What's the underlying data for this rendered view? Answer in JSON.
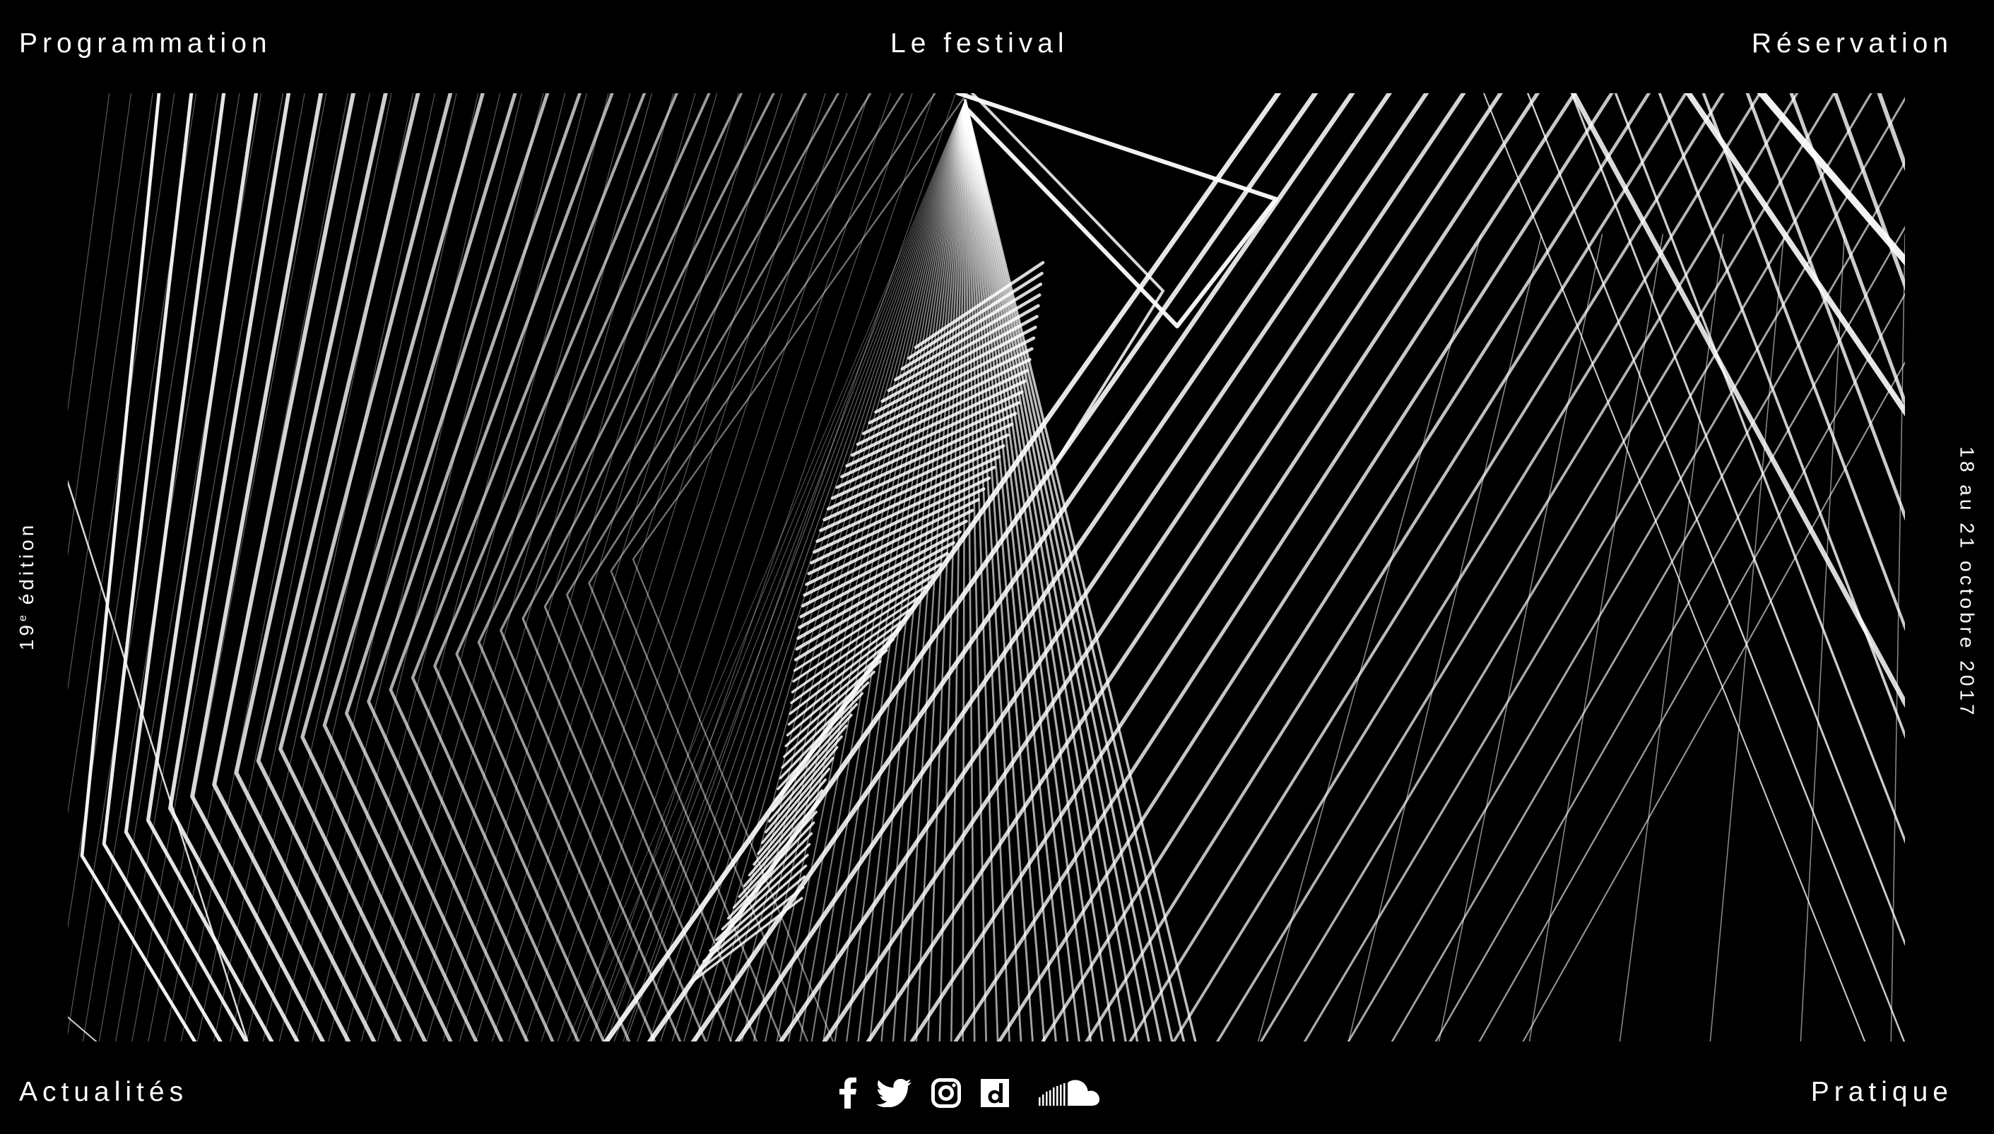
{
  "nav": {
    "top_left": "Programmation",
    "top_center": "Le festival",
    "top_right": "Réservation",
    "bottom_left": "Actualités",
    "bottom_right": "Pratique"
  },
  "side": {
    "edition_number": "19",
    "edition_suffix": "e",
    "edition_word": " édition",
    "dates": "18 au 21 octobre 2017"
  },
  "social": [
    {
      "icon": "facebook-icon"
    },
    {
      "icon": "twitter-icon"
    },
    {
      "icon": "instagram-icon"
    },
    {
      "icon": "dailymotion-icon"
    },
    {
      "icon": "soundcloud-icon"
    }
  ],
  "colors": {
    "background": "#000000",
    "foreground": "#ffffff"
  }
}
